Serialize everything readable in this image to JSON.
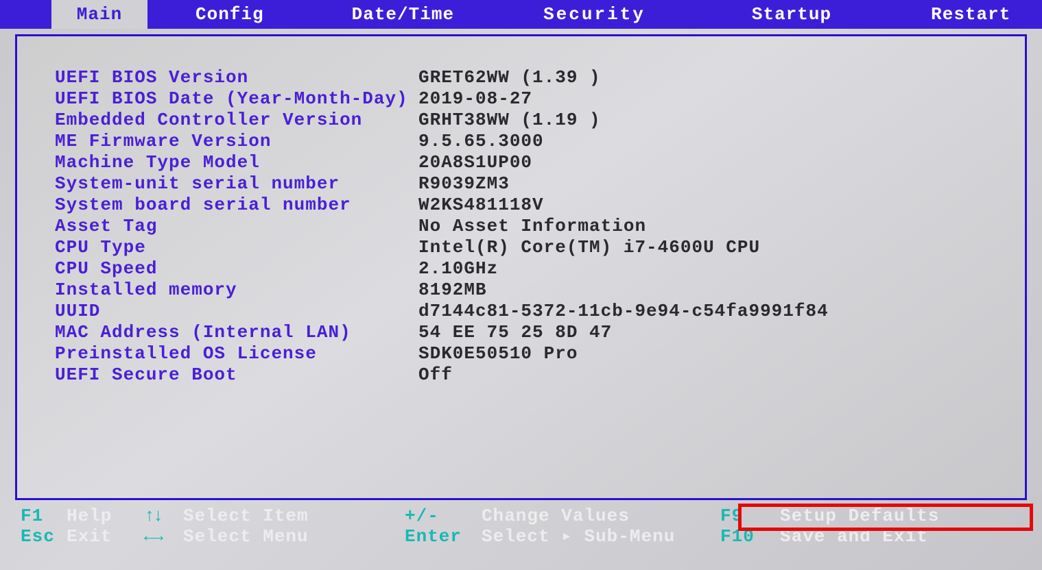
{
  "tabs": {
    "main": "Main",
    "config": "Config",
    "datetime": "Date/Time",
    "security": "Security",
    "startup": "Startup",
    "restart": "Restart"
  },
  "info": [
    {
      "label": "UEFI BIOS Version",
      "value": "GRET62WW (1.39 )"
    },
    {
      "label": "UEFI BIOS Date (Year-Month-Day)",
      "value": "2019-08-27"
    },
    {
      "label": "Embedded Controller Version",
      "value": "GRHT38WW (1.19 )"
    },
    {
      "label": "ME Firmware Version",
      "value": "9.5.65.3000"
    },
    {
      "label": "Machine Type Model",
      "value": "20A8S1UP00"
    },
    {
      "label": "System-unit serial number",
      "value": "R9039ZM3"
    },
    {
      "label": "System board serial number",
      "value": "W2KS481118V"
    },
    {
      "label": "Asset Tag",
      "value": "No Asset Information"
    },
    {
      "label": "CPU Type",
      "value": "Intel(R) Core(TM) i7-4600U CPU"
    },
    {
      "label": "CPU Speed",
      "value": "2.10GHz"
    },
    {
      "label": "Installed memory",
      "value": "8192MB"
    },
    {
      "label": "UUID",
      "value": "d7144c81-5372-11cb-9e94-c54fa9991f84"
    },
    {
      "label": "MAC Address (Internal LAN)",
      "value": "54 EE 75 25 8D 47"
    },
    {
      "label": "Preinstalled OS License",
      "value": "SDK0E50510 Pro"
    },
    {
      "label": "UEFI Secure Boot",
      "value": "Off"
    }
  ],
  "footer": {
    "f1": {
      "key": "F1",
      "label": "Help"
    },
    "esc": {
      "key": "Esc",
      "label": "Exit"
    },
    "updown": {
      "key": "↑↓",
      "label": "Select Item"
    },
    "leftright": {
      "key": "←→",
      "label": "Select Menu"
    },
    "plusminus": {
      "key": "+/-",
      "label": "Change Values"
    },
    "enter": {
      "key": "Enter",
      "label": "Select ▸ Sub-Menu"
    },
    "f9": {
      "key": "F9",
      "label": "Setup Defaults"
    },
    "f10": {
      "key": "F10",
      "label": "Save and Exit"
    }
  }
}
